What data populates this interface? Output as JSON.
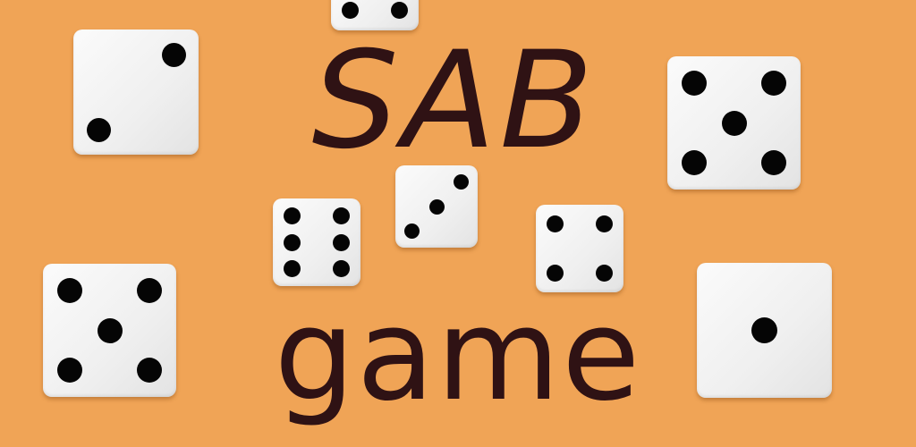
{
  "theme": {
    "background": "#f0a456",
    "title_color": "#2f1214",
    "die_face": "#f2f2f2",
    "pip_color": "#050505"
  },
  "title": {
    "line1": "SAB",
    "line2": "game"
  },
  "dice": [
    {
      "name": "die-top-partial",
      "value": 2
    },
    {
      "name": "die-top-left",
      "value": 2
    },
    {
      "name": "die-top-right",
      "value": 5
    },
    {
      "name": "die-center-left",
      "value": 6
    },
    {
      "name": "die-center",
      "value": 3
    },
    {
      "name": "die-center-right",
      "value": 4
    },
    {
      "name": "die-bottom-left",
      "value": 5
    },
    {
      "name": "die-bottom-right",
      "value": 1
    }
  ]
}
